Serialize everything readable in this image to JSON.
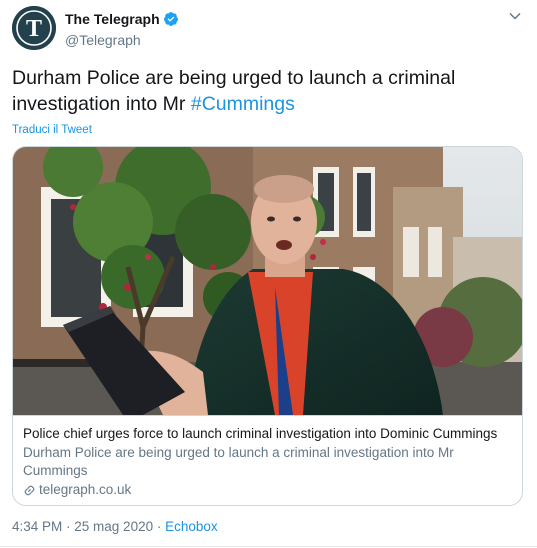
{
  "author": {
    "display_name": "The Telegraph",
    "handle": "@Telegraph",
    "verified": true,
    "avatar_icon": "telegraph-t-logo",
    "avatar_letter": "T"
  },
  "tweet": {
    "text_before": "Durham Police are being urged to launch a criminal investigation into Mr ",
    "hashtag": "#Cummings",
    "translate_label": "Traduci il Tweet"
  },
  "card": {
    "image_icon": "news-photo",
    "title": "Police chief urges force to launch criminal investigation into Dominic Cummings",
    "description": "Durham Police are being urged to launch a criminal investigation into Mr Cummings",
    "domain": "telegraph.co.uk",
    "link_icon": "link-icon"
  },
  "meta": {
    "time": "4:34 PM",
    "separator1": " · ",
    "date": "25 mag 2020",
    "separator2": " · ",
    "source": "Echobox"
  },
  "colors": {
    "accent": "#1b95e0",
    "text": "#14171a",
    "secondary": "#657786",
    "border": "#ccd6dd",
    "verified": "#1da1f2"
  }
}
